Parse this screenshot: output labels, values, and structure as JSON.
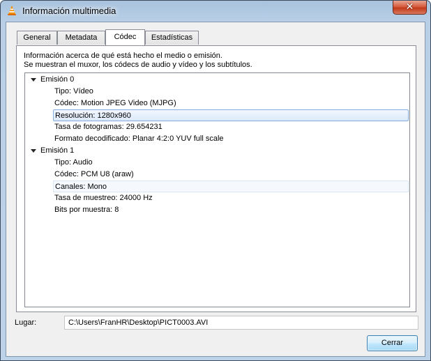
{
  "window": {
    "title": "Información multimedia",
    "close_label": "✕"
  },
  "tabs": [
    "General",
    "Metadata",
    "Códec",
    "Estadísticas"
  ],
  "active_tab": "Códec",
  "description": {
    "line1": "Información acerca de qué está hecho el medio o emisión.",
    "line2": "Se muestran el muxor, los códecs de audio y vídeo y los subtítulos."
  },
  "streams": [
    {
      "name": "Emisión 0",
      "props": [
        "Tipo: Vídeo",
        "Códec: Motion JPEG Video (MJPG)",
        "Resolución: 1280x960",
        "Tasa de fotogramas: 29.654231",
        "Formato decodificado: Planar 4:2:0 YUV full scale"
      ]
    },
    {
      "name": "Emisión 1",
      "props": [
        "Tipo: Audio",
        "Códec: PCM U8 (araw)",
        "Canales: Mono",
        "Tasa de muestreo: 24000 Hz",
        "Bits por muestra: 8"
      ]
    }
  ],
  "location": {
    "label": "Lugar:",
    "value": "C:\\Users\\FranHR\\Desktop\\PICT0003.AVI"
  },
  "close_button": "Cerrar",
  "colors": {
    "accent": "#3c7fb1",
    "selection_border": "#84acdd"
  }
}
